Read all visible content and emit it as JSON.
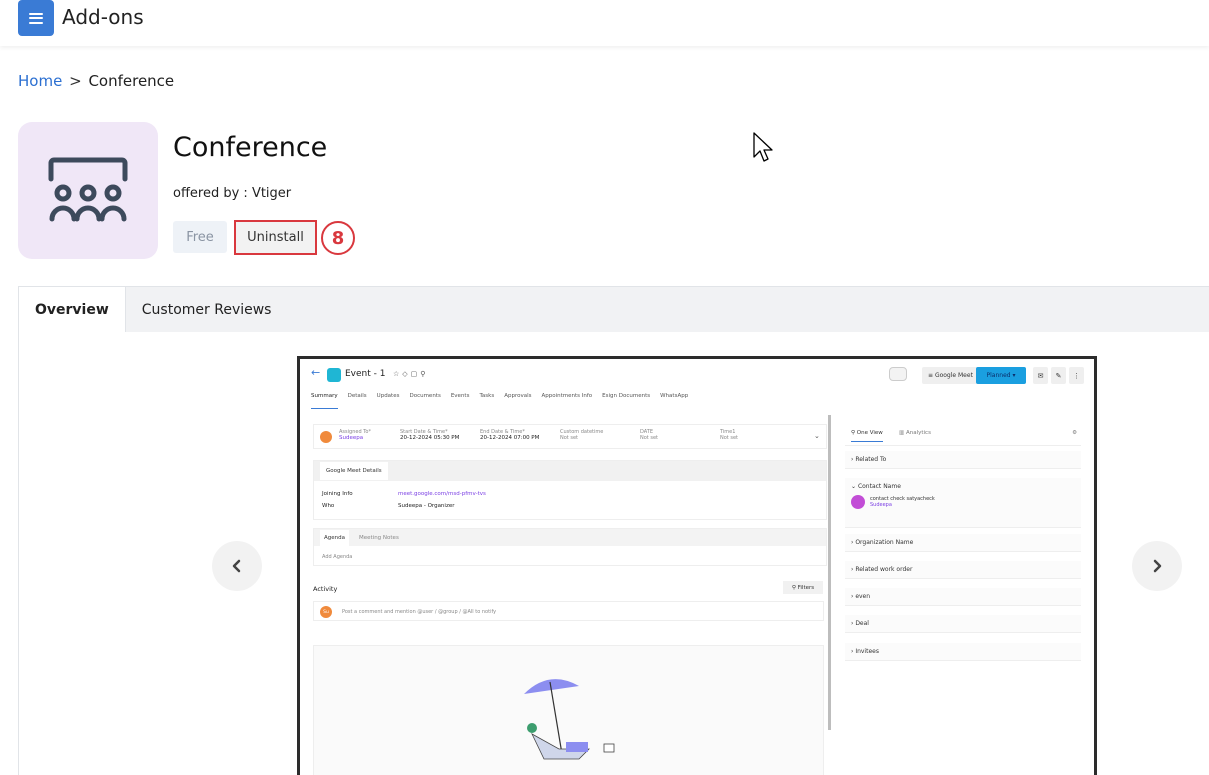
{
  "header": {
    "title": "Add-ons",
    "menu_icon": "hamburger-menu-icon"
  },
  "breadcrumb": {
    "home": "Home",
    "separator": ">",
    "current": "Conference"
  },
  "addon": {
    "title": "Conference",
    "offered_by": "offered by : Vtiger",
    "price": "Free",
    "action_label": "Uninstall",
    "step_number": "8",
    "icon": "conference-people-icon",
    "icon_bg": "#f0e7f7",
    "highlight_color": "#d9383e"
  },
  "tabs": [
    {
      "label": "Overview",
      "active": true
    },
    {
      "label": "Customer Reviews",
      "active": false
    }
  ],
  "carousel": {
    "prev_icon": "chevron-left-icon",
    "next_icon": "chevron-right-icon",
    "screenshot": {
      "event_title": "Event - 1",
      "meet_label": "Google Meet",
      "status": "Planned",
      "nav": [
        "Summary",
        "Details",
        "Updates",
        "Documents",
        "Events",
        "Tasks",
        "Approvals",
        "Appointments Info",
        "Esign Documents",
        "WhatsApp"
      ],
      "fields": [
        {
          "label": "Assigned To*",
          "value": "Sudeepa"
        },
        {
          "label": "Start Date & Time*",
          "value": "20-12-2024 05:30 PM"
        },
        {
          "label": "End Date & Time*",
          "value": "20-12-2024 07:00 PM"
        },
        {
          "label": "Custom datetime",
          "value": "Not set"
        },
        {
          "label": "DATE",
          "value": "Not set"
        },
        {
          "label": "Time1",
          "value": "Not set"
        }
      ],
      "meet_details_title": "Google Meet Details",
      "joining_label": "Joining Info",
      "joining_value": "meet.google.com/msd-pfmv-tvs",
      "who_label": "Who",
      "who_value": "Sudeepa - Organizer",
      "agenda_tab": "Agenda",
      "notes_tab": "Meeting Notes",
      "add_agenda": "Add Agenda",
      "activity_label": "Activity",
      "filters_label": "Filters",
      "comment_placeholder": "Post a comment and mention @user / @group / @All to notify",
      "avatar_initials": "Su",
      "right_tabs": [
        "One View",
        "Analytics"
      ],
      "right_sections": [
        "Related To",
        "Contact Name",
        "Organization Name",
        "Related work order",
        "even",
        "Deal",
        "Invitees"
      ],
      "contact_name": "contact check satyacheck",
      "contact_owner": "Sudeepa"
    }
  }
}
